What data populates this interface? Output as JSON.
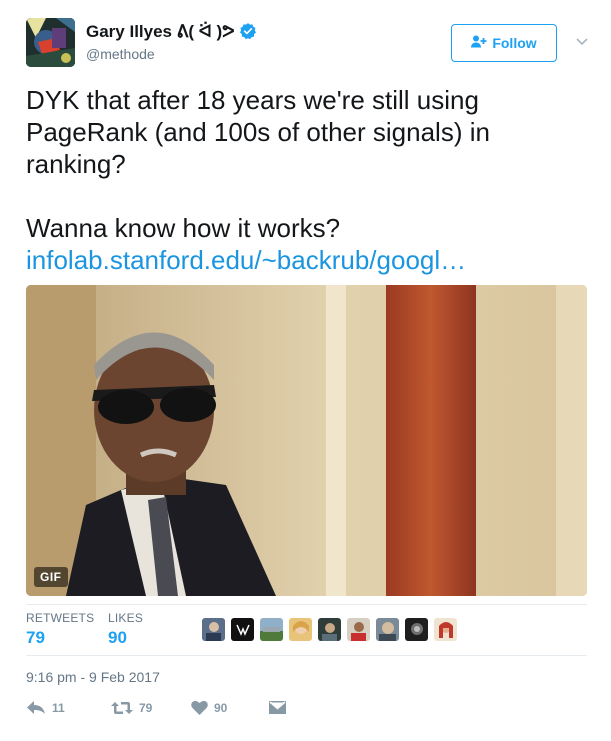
{
  "user": {
    "name": "Gary Illyes ᕕ( ᐛ )ᕗ",
    "handle": "@methode"
  },
  "follow_button": {
    "label": "Follow"
  },
  "tweet": {
    "paragraph1": "DYK that after 18 years we're still using PageRank (and 100s of other signals) in ranking?",
    "paragraph2": "Wanna know how it works?",
    "link_text": "infolab.stanford.edu/~backrub/googl…"
  },
  "media": {
    "badge": "GIF"
  },
  "stats": {
    "retweets_label": "RETWEETS",
    "retweets_count": "79",
    "likes_label": "LIKES",
    "likes_count": "90"
  },
  "timestamp": "9:16 pm - 9 Feb 2017",
  "actions": {
    "reply_count": "11",
    "retweet_count": "79",
    "like_count": "90"
  },
  "colors": {
    "accent": "#1da1f2",
    "link": "#1b95e0",
    "muted": "#657786",
    "icon": "#8899a6"
  }
}
